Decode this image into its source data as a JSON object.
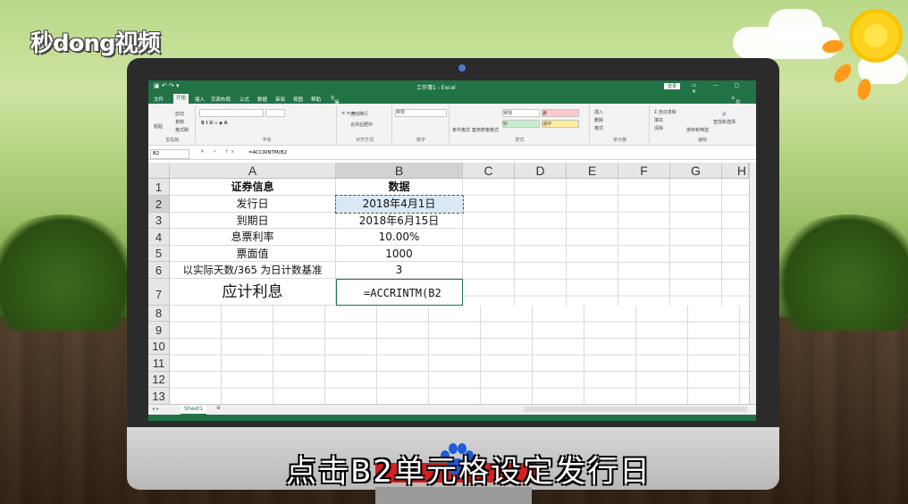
{
  "watermark": {
    "logo_text": "秒dong视频"
  },
  "excel": {
    "window_title": "工作簿1 - Excel",
    "login_label": "登录",
    "share_label": "共享",
    "tabs": [
      "文件",
      "开始",
      "插入",
      "页面布局",
      "公式",
      "数据",
      "审阅",
      "视图",
      "帮助"
    ],
    "tell_me": "操作说明搜索",
    "ribbon": {
      "paste": "粘贴",
      "cut": "剪切",
      "copy": "复制",
      "format_painter": "格式刷",
      "clipboard": "剪贴板",
      "font": "字体",
      "alignment": "对齐方式",
      "wrap_text": "自动换行",
      "merge_center": "合并后居中",
      "number": "数字",
      "number_format": "常规",
      "styles": "样式",
      "cond_format": "条件格式",
      "format_table": "套用表格格式",
      "style_normal": "常规",
      "style_bad": "差",
      "style_good": "好",
      "style_neutral": "适中",
      "cells": "单元格",
      "insert": "插入",
      "delete": "删除",
      "format": "格式",
      "editing": "编辑",
      "autosum": "自动求和",
      "fill": "填充",
      "clear": "清除",
      "sort_filter": "排序和筛选",
      "find_select": "查找和选择"
    },
    "name_box": "B2",
    "formula": "=ACCRINTM(B2",
    "columns": [
      "A",
      "B",
      "C",
      "D",
      "E",
      "F",
      "G",
      "H"
    ],
    "rows": [
      "1",
      "2",
      "3",
      "4",
      "5",
      "6",
      "7",
      "8",
      "9",
      "10",
      "11",
      "12",
      "13"
    ],
    "cells": {
      "a1": "证券信息",
      "b1": "数据",
      "a2": "发行日",
      "b2": "2018年4月1日",
      "a3": "到期日",
      "b3": "2018年6月15日",
      "a4": "息票利率",
      "b4": "10.00%",
      "a5": "票面值",
      "b5": "1000",
      "a6": "以实际天数/365 为日计数基准",
      "b6": "3",
      "a7": "应计利息",
      "b7": "=ACCRINTM(B2"
    },
    "sheet_tab": "Sheet1",
    "accent": "#217346"
  },
  "subtitle": "点击B2单元格设定发行日"
}
